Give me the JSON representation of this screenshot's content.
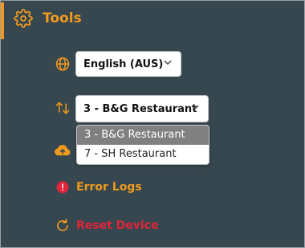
{
  "header": {
    "title": "Tools",
    "icon": "gear-icon"
  },
  "colors": {
    "accent": "#f09a1d",
    "danger": "#e0243a",
    "panel": "#37474f"
  },
  "language": {
    "icon": "globe-icon",
    "value": "English (AUS)"
  },
  "restaurant": {
    "icon": "sort-arrows-icon",
    "value": "3 - B&G Restaurant",
    "options": [
      "3 - B&G Restaurant",
      "7 - SH Restaurant"
    ],
    "selected_index": 0
  },
  "upload": {
    "icon": "cloud-upload-icon"
  },
  "error_logs": {
    "icon": "alert-circle-icon",
    "label": "Error Logs"
  },
  "reset_device": {
    "icon": "refresh-icon",
    "label": "Reset Device"
  }
}
